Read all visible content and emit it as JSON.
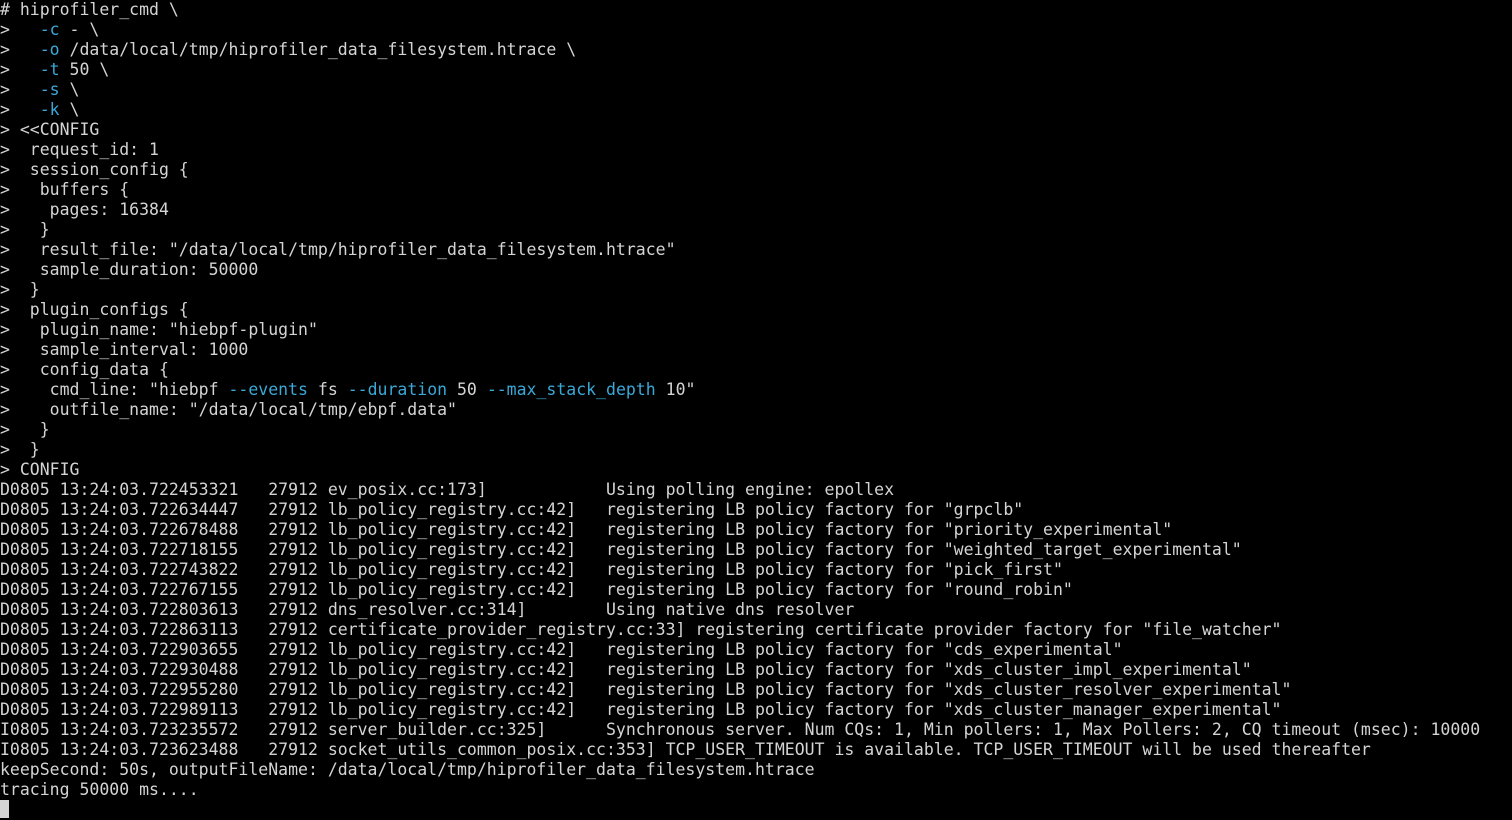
{
  "terminal": {
    "lines": [
      {
        "segments": [
          {
            "t": "# hiprofiler_cmd \\",
            "c": "text"
          }
        ]
      },
      {
        "segments": [
          {
            "t": ">   ",
            "c": "text"
          },
          {
            "t": "-c",
            "c": "opt"
          },
          {
            "t": " - \\",
            "c": "text"
          }
        ]
      },
      {
        "segments": [
          {
            "t": ">   ",
            "c": "text"
          },
          {
            "t": "-o",
            "c": "opt"
          },
          {
            "t": " /data/local/tmp/hiprofiler_data_filesystem.htrace \\",
            "c": "text"
          }
        ]
      },
      {
        "segments": [
          {
            "t": ">   ",
            "c": "text"
          },
          {
            "t": "-t",
            "c": "opt"
          },
          {
            "t": " 50 \\",
            "c": "text"
          }
        ]
      },
      {
        "segments": [
          {
            "t": ">   ",
            "c": "text"
          },
          {
            "t": "-s",
            "c": "opt"
          },
          {
            "t": " \\",
            "c": "text"
          }
        ]
      },
      {
        "segments": [
          {
            "t": ">   ",
            "c": "text"
          },
          {
            "t": "-k",
            "c": "opt"
          },
          {
            "t": " \\",
            "c": "text"
          }
        ]
      },
      {
        "segments": [
          {
            "t": "> <<CONFIG",
            "c": "text"
          }
        ]
      },
      {
        "segments": [
          {
            "t": ">  request_id: 1",
            "c": "text"
          }
        ]
      },
      {
        "segments": [
          {
            "t": ">  session_config {",
            "c": "text"
          }
        ]
      },
      {
        "segments": [
          {
            "t": ">   buffers {",
            "c": "text"
          }
        ]
      },
      {
        "segments": [
          {
            "t": ">    pages: 16384",
            "c": "text"
          }
        ]
      },
      {
        "segments": [
          {
            "t": ">   }",
            "c": "text"
          }
        ]
      },
      {
        "segments": [
          {
            "t": ">   result_file: \"/data/local/tmp/hiprofiler_data_filesystem.htrace\"",
            "c": "text"
          }
        ]
      },
      {
        "segments": [
          {
            "t": ">   sample_duration: 50000",
            "c": "text"
          }
        ]
      },
      {
        "segments": [
          {
            "t": ">  }",
            "c": "text"
          }
        ]
      },
      {
        "segments": [
          {
            "t": ">  plugin_configs {",
            "c": "text"
          }
        ]
      },
      {
        "segments": [
          {
            "t": ">   plugin_name: \"hiebpf-plugin\"",
            "c": "text"
          }
        ]
      },
      {
        "segments": [
          {
            "t": ">   sample_interval: 1000",
            "c": "text"
          }
        ]
      },
      {
        "segments": [
          {
            "t": ">   config_data {",
            "c": "text"
          }
        ]
      },
      {
        "segments": [
          {
            "t": ">    cmd_line: \"hiebpf ",
            "c": "text"
          },
          {
            "t": "--events",
            "c": "opt"
          },
          {
            "t": " fs ",
            "c": "text"
          },
          {
            "t": "--duration",
            "c": "opt"
          },
          {
            "t": " 50 ",
            "c": "text"
          },
          {
            "t": "--max_stack_depth",
            "c": "opt"
          },
          {
            "t": " 10\"",
            "c": "text"
          }
        ]
      },
      {
        "segments": [
          {
            "t": ">    outfile_name: \"/data/local/tmp/ebpf.data\"",
            "c": "text"
          }
        ]
      },
      {
        "segments": [
          {
            "t": ">   }",
            "c": "text"
          }
        ]
      },
      {
        "segments": [
          {
            "t": ">  }",
            "c": "text"
          }
        ]
      },
      {
        "segments": [
          {
            "t": "> CONFIG",
            "c": "text"
          }
        ]
      },
      {
        "segments": [
          {
            "t": "D0805 13:24:03.722453321   27912 ev_posix.cc:173]            Using polling engine: epollex",
            "c": "text"
          }
        ]
      },
      {
        "segments": [
          {
            "t": "D0805 13:24:03.722634447   27912 lb_policy_registry.cc:42]   registering LB policy factory for \"grpclb\"",
            "c": "text"
          }
        ]
      },
      {
        "segments": [
          {
            "t": "D0805 13:24:03.722678488   27912 lb_policy_registry.cc:42]   registering LB policy factory for \"priority_experimental\"",
            "c": "text"
          }
        ]
      },
      {
        "segments": [
          {
            "t": "D0805 13:24:03.722718155   27912 lb_policy_registry.cc:42]   registering LB policy factory for \"weighted_target_experimental\"",
            "c": "text"
          }
        ]
      },
      {
        "segments": [
          {
            "t": "D0805 13:24:03.722743822   27912 lb_policy_registry.cc:42]   registering LB policy factory for \"pick_first\"",
            "c": "text"
          }
        ]
      },
      {
        "segments": [
          {
            "t": "D0805 13:24:03.722767155   27912 lb_policy_registry.cc:42]   registering LB policy factory for \"round_robin\"",
            "c": "text"
          }
        ]
      },
      {
        "segments": [
          {
            "t": "D0805 13:24:03.722803613   27912 dns_resolver.cc:314]        Using native dns resolver",
            "c": "text"
          }
        ]
      },
      {
        "segments": [
          {
            "t": "D0805 13:24:03.722863113   27912 certificate_provider_registry.cc:33] registering certificate provider factory for \"file_watcher\"",
            "c": "text"
          }
        ]
      },
      {
        "segments": [
          {
            "t": "D0805 13:24:03.722903655   27912 lb_policy_registry.cc:42]   registering LB policy factory for \"cds_experimental\"",
            "c": "text"
          }
        ]
      },
      {
        "segments": [
          {
            "t": "D0805 13:24:03.722930488   27912 lb_policy_registry.cc:42]   registering LB policy factory for \"xds_cluster_impl_experimental\"",
            "c": "text"
          }
        ]
      },
      {
        "segments": [
          {
            "t": "D0805 13:24:03.722955280   27912 lb_policy_registry.cc:42]   registering LB policy factory for \"xds_cluster_resolver_experimental\"",
            "c": "text"
          }
        ]
      },
      {
        "segments": [
          {
            "t": "D0805 13:24:03.722989113   27912 lb_policy_registry.cc:42]   registering LB policy factory for \"xds_cluster_manager_experimental\"",
            "c": "text"
          }
        ]
      },
      {
        "segments": [
          {
            "t": "I0805 13:24:03.723235572   27912 server_builder.cc:325]      Synchronous server. Num CQs: 1, Min pollers: 1, Max Pollers: 2, CQ timeout (msec): 10000",
            "c": "text"
          }
        ]
      },
      {
        "segments": [
          {
            "t": "I0805 13:24:03.723623488   27912 socket_utils_common_posix.cc:353] TCP_USER_TIMEOUT is available. TCP_USER_TIMEOUT will be used thereafter",
            "c": "text"
          }
        ]
      },
      {
        "segments": [
          {
            "t": "keepSecond: 50s, outputFileName: /data/local/tmp/hiprofiler_data_filesystem.htrace",
            "c": "text"
          }
        ]
      },
      {
        "segments": [
          {
            "t": "tracing 50000 ms....",
            "c": "text"
          }
        ]
      }
    ]
  },
  "colors": {
    "background": "#000000",
    "text": "#d4d4d4",
    "option": "#3aa8d8"
  }
}
